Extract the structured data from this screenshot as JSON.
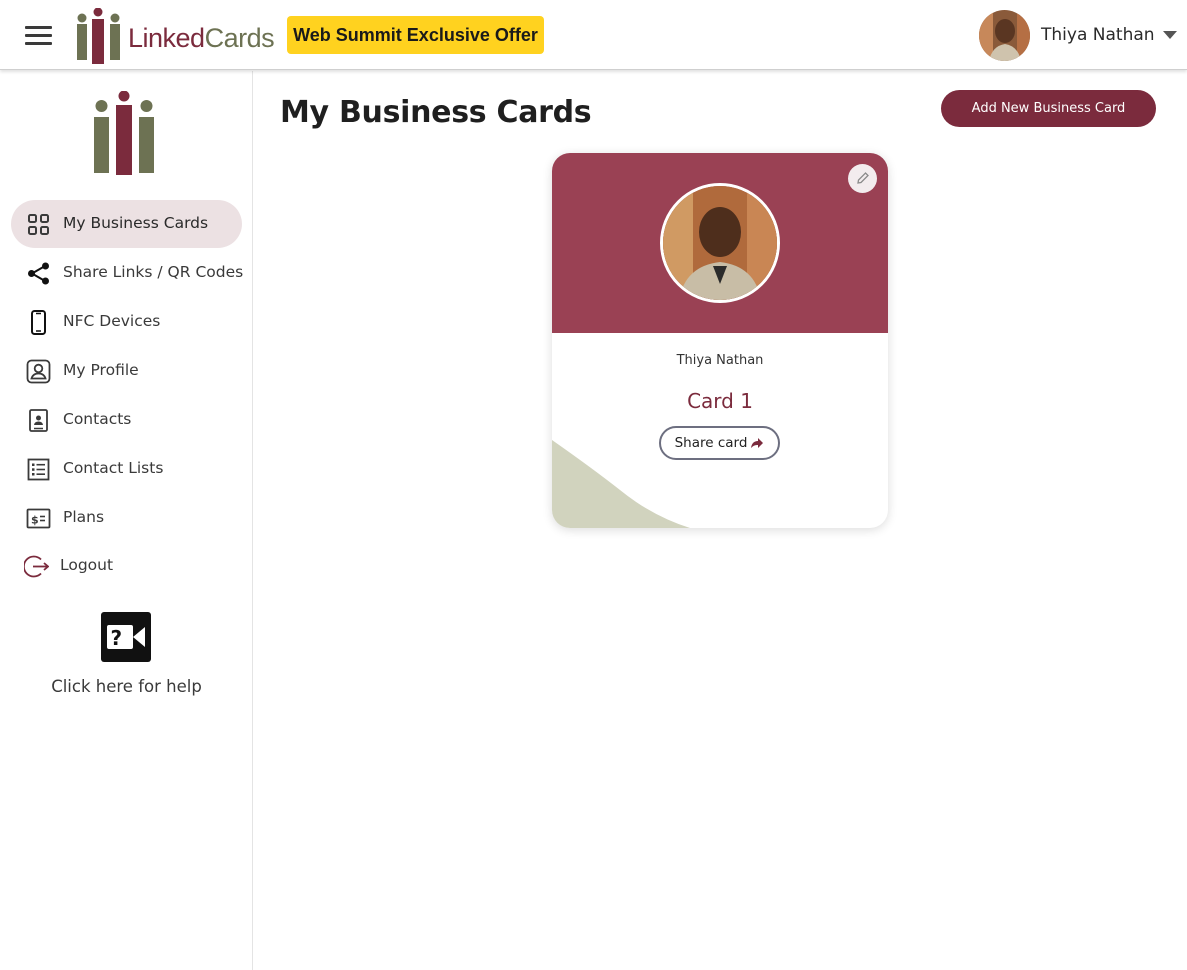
{
  "header": {
    "logo_text_part1": "Linked",
    "logo_text_part2": "Cards",
    "offer_label": "Web Summit Exclusive Offer",
    "user_name": "Thiya Nathan",
    "menu_icon": "hamburger-menu-icon",
    "dropdown_icon": "caret-down-icon"
  },
  "sidebar": {
    "items": [
      {
        "label": "My Business Cards",
        "icon": "grid-icon",
        "active": true
      },
      {
        "label": "Share Links / QR Codes",
        "icon": "share-icon",
        "active": false
      },
      {
        "label": "NFC Devices",
        "icon": "phone-icon",
        "active": false
      },
      {
        "label": "My Profile",
        "icon": "profile-icon",
        "active": false
      },
      {
        "label": "Contacts",
        "icon": "contact-book-icon",
        "active": false
      },
      {
        "label": "Contact Lists",
        "icon": "list-icon",
        "active": false
      },
      {
        "label": "Plans",
        "icon": "dollar-icon",
        "active": false
      },
      {
        "label": "Logout",
        "icon": "logout-icon",
        "active": false
      }
    ],
    "help_text": "Click here for help",
    "help_icon": "video-help-icon"
  },
  "main": {
    "title": "My Business Cards",
    "add_button": "Add New Business Card",
    "cards": [
      {
        "owner": "Thiya Nathan",
        "title": "Card 1",
        "share_label": "Share card"
      }
    ]
  },
  "colors": {
    "brand": "#7b2b3d",
    "card_header": "#9a4154",
    "offer_bg": "#ffd21f",
    "active_nav_bg": "#ece1e3",
    "olive": "#6d7253"
  }
}
